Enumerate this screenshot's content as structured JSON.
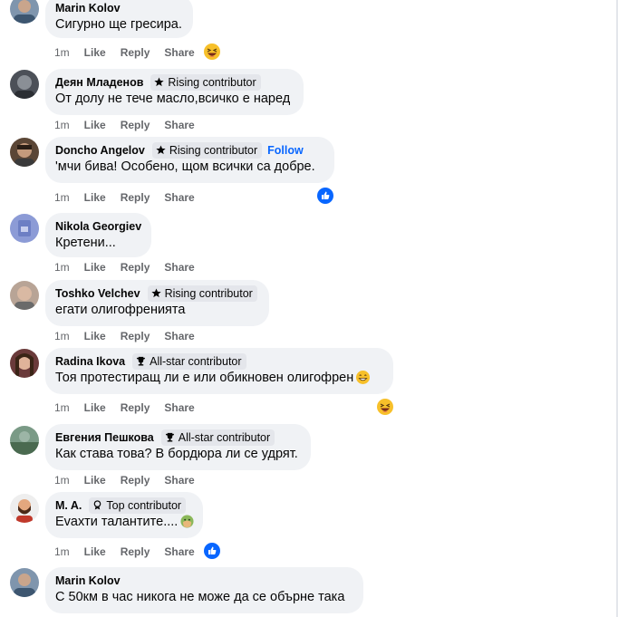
{
  "comments": [
    {
      "author": "Marin Kolov",
      "badge": "",
      "follow": "",
      "text": "Сигурно ще гресира.",
      "time": "1m",
      "like": "Like",
      "reply": "Reply",
      "share": "Share",
      "reaction": "haha",
      "avatar_color": "#6f8aa8"
    },
    {
      "author": "Деян Младенов",
      "badge": "Rising contributor",
      "follow": "",
      "text": "От долу не тече масло,всичко е наред",
      "time": "1m",
      "like": "Like",
      "reply": "Reply",
      "share": "Share",
      "reaction": "",
      "avatar_color": "#4a4f57"
    },
    {
      "author": "Doncho Angelov",
      "badge": "Rising contributor",
      "follow": "Follow",
      "text": "'мчи бива! Особено, щом всички са добре.",
      "time": "1m",
      "like": "Like",
      "reply": "Reply",
      "share": "Share",
      "reaction": "like",
      "avatar_color": "#7a5a44"
    },
    {
      "author": "Nikola Georgiev",
      "badge": "",
      "follow": "",
      "text": "Кретени...",
      "time": "1m",
      "like": "Like",
      "reply": "Reply",
      "share": "Share",
      "reaction": "",
      "avatar_color": "#8c9bd6"
    },
    {
      "author": "Toshko Velchev",
      "badge": "Rising contributor",
      "follow": "",
      "text": "егати олигофренията",
      "time": "1m",
      "like": "Like",
      "reply": "Reply",
      "share": "Share",
      "reaction": "",
      "avatar_color": "#a58a7a"
    },
    {
      "author": "Radina Ikova",
      "badge": "All-star contributor",
      "follow": "",
      "text": "Тоя протестиращ ли е или обикновен олигофрен",
      "time": "1m",
      "like": "Like",
      "reply": "Reply",
      "share": "Share",
      "reaction": "haha",
      "avatar_color": "#8a5a5a"
    },
    {
      "author": "Евгения Пешкова",
      "badge": "All-star contributor",
      "follow": "",
      "text": "Как става това? В бордюра ли се удрят.",
      "time": "1m",
      "like": "Like",
      "reply": "Reply",
      "share": "Share",
      "reaction": "",
      "avatar_color": "#5e7a6a"
    },
    {
      "author": "M. A.",
      "badge": "Top contributor",
      "follow": "",
      "text": "Еvахти талантите....",
      "time": "1m",
      "like": "Like",
      "reply": "Reply",
      "share": "Share",
      "reaction": "like",
      "avatar_color": "#d9d9d9"
    },
    {
      "author": "Marin Kolov",
      "badge": "",
      "follow": "",
      "text": "С 50км в час никога не може да се обърне така",
      "time": "",
      "like": "",
      "reply": "",
      "share": "",
      "reaction": "",
      "avatar_color": "#6f8aa8"
    }
  ],
  "colors": {
    "bubble": "#f0f2f5",
    "meta": "#65676b",
    "link": "#0866ff",
    "like_blue": "#0866ff",
    "haha_yellow": "#f7c02a"
  },
  "icons": {
    "rising": "star-icon",
    "all_star": "trophy-icon",
    "top": "medal-icon",
    "like_reaction": "thumbs-up-icon",
    "haha_reaction": "laughing-emoji-icon",
    "grin": "grinning-emoji-icon",
    "facepalm": "facepalm-emoji-icon"
  }
}
